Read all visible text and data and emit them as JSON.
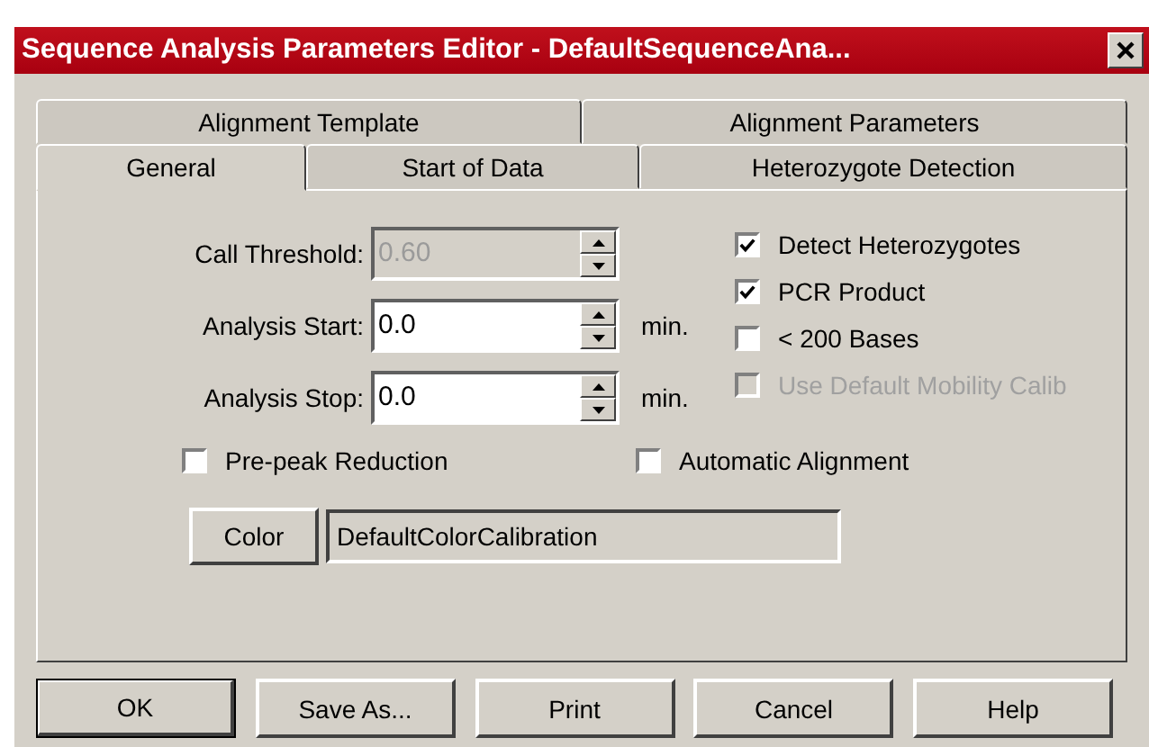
{
  "window": {
    "title": "Sequence Analysis Parameters Editor - DefaultSequenceAna..."
  },
  "tab_rows": [
    {
      "tabs": [
        {
          "label": "Alignment Template",
          "selected": false
        },
        {
          "label": "Alignment Parameters",
          "selected": false
        }
      ]
    },
    {
      "tabs": [
        {
          "label": "General",
          "selected": true
        },
        {
          "label": "Start of Data",
          "selected": false
        },
        {
          "label": "Heterozygote Detection",
          "selected": false
        }
      ]
    }
  ],
  "fields": [
    {
      "label": "Call Threshold:",
      "value": "0.60",
      "disabled": true
    },
    {
      "label": "Analysis Start:",
      "value": "0.0",
      "disabled": false,
      "unit": "min."
    },
    {
      "label": "Analysis Stop:",
      "value": "0.0",
      "disabled": false,
      "unit": "min."
    }
  ],
  "options": [
    {
      "label": "Detect Heterozygotes",
      "checked": true,
      "disabled": false
    },
    {
      "label": "PCR Product",
      "checked": true,
      "disabled": false
    },
    {
      "label": "< 200 Bases",
      "checked": false,
      "disabled": false
    },
    {
      "label": "Use Default Mobility Calib",
      "checked": false,
      "disabled": true
    }
  ],
  "bottom_options": [
    {
      "label": "Pre-peak Reduction",
      "checked": false,
      "disabled": false
    },
    {
      "label": "Automatic Alignment",
      "checked": false,
      "disabled": false
    }
  ],
  "color": {
    "button": "Color",
    "value": "DefaultColorCalibration"
  },
  "buttons": [
    {
      "label": "OK",
      "default": true
    },
    {
      "label": "Save As...",
      "default": false
    },
    {
      "label": "Print",
      "default": false
    },
    {
      "label": "Cancel",
      "default": false
    },
    {
      "label": "Help",
      "default": false
    }
  ]
}
